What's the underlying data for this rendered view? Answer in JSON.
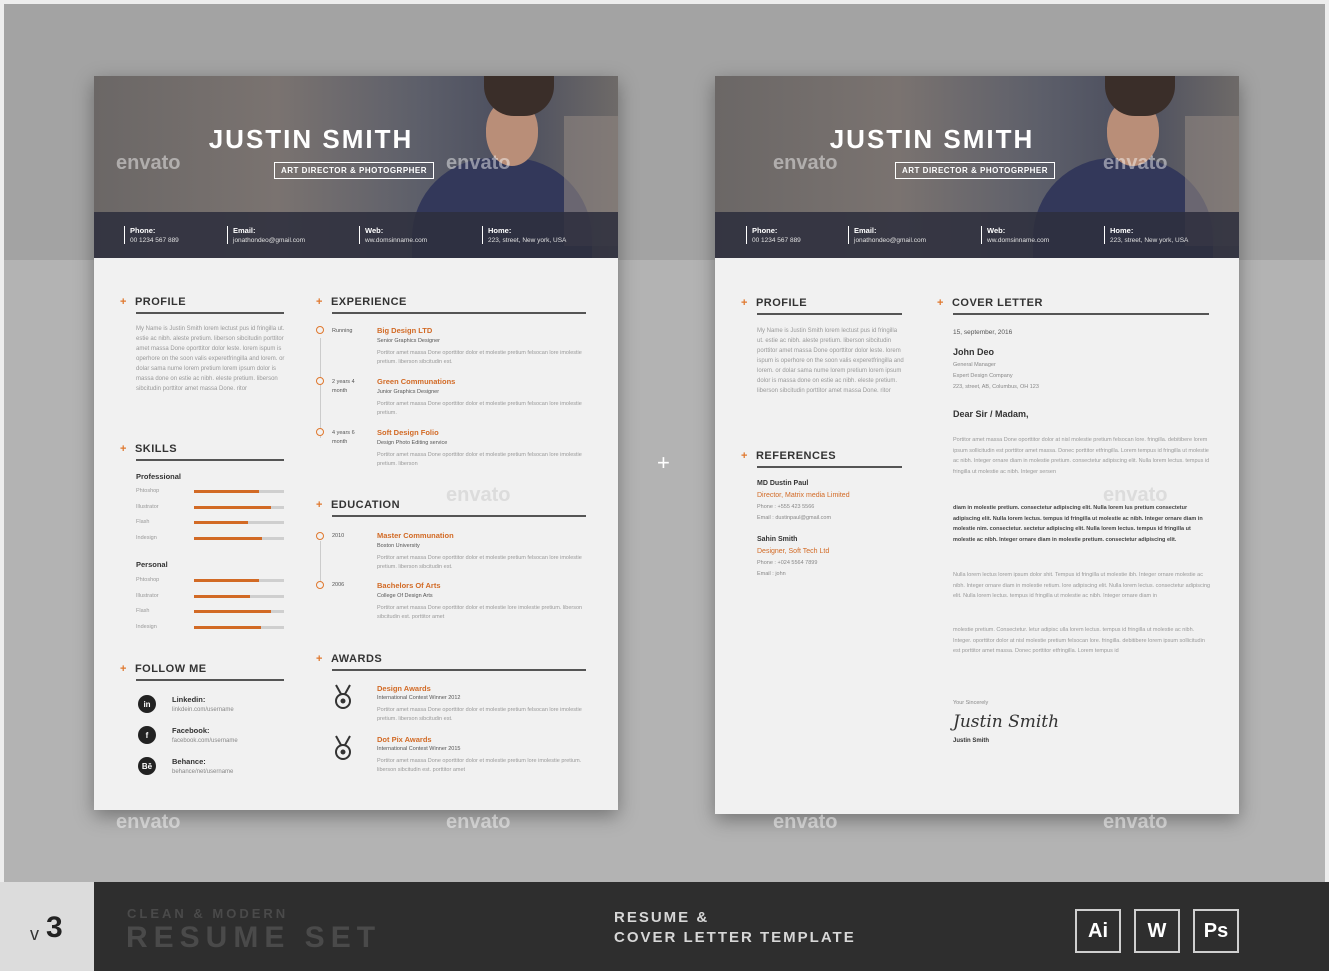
{
  "resume": {
    "name": "JUSTIN SMITH",
    "role": "ART DIRECTOR & PHOTOGRPHER",
    "contacts": [
      {
        "label": "Phone:",
        "value": "00 1234 567 889"
      },
      {
        "label": "Email:",
        "value": "jonathondeo@gmail.com"
      },
      {
        "label": "Web:",
        "value": "ww.domsinname.com"
      },
      {
        "label": "Home:",
        "value": "223, street, New york, USA"
      }
    ],
    "profile": {
      "title": "PROFILE",
      "text": "My Name is Justin Smith lorem lectust pus id fringilla ut. estie ac nibh. aleste pretium. liberson sibcitudin porttitor amet massa Done oporttitor dolor leste. lorem ispum is operhore on the soon valis experetfringilla and lorem. or dolar sama nume lorem pretium lorem ipsum dolor is massa done on estie ac nibh. eleste pretium. liberson sibcitudin porttitor amet massa Done. ritor"
    },
    "skills": {
      "title": "SKILLS",
      "professional_label": "Professional",
      "professional": [
        {
          "name": "Phtoshop",
          "level": 0.72
        },
        {
          "name": "Illustrator",
          "level": 0.85
        },
        {
          "name": "Flash",
          "level": 0.6
        },
        {
          "name": "Indesign",
          "level": 0.75
        }
      ],
      "personal_label": "Personal",
      "personal": [
        {
          "name": "Phtoshop",
          "level": 0.72
        },
        {
          "name": "Illustrator",
          "level": 0.62
        },
        {
          "name": "Flash",
          "level": 0.85
        },
        {
          "name": "Indesign",
          "level": 0.74
        }
      ]
    },
    "follow": {
      "title": "FOLLOW ME",
      "items": [
        {
          "icon": "in",
          "label": "Linkedin:",
          "value": "linkdein.com/username"
        },
        {
          "icon": "f",
          "label": "Facebook:",
          "value": "facebook.com/username"
        },
        {
          "icon": "Bē",
          "label": "Behance:",
          "value": "behance/net/username"
        }
      ]
    },
    "experience": {
      "title": "EXPERIENCE",
      "items": [
        {
          "period": "Running",
          "company": "Big Design LTD",
          "position": "Senior Graphics Designer",
          "desc": "Portitor amet massa Done oporttitor dolor et molestie pretium felsocan lore imolestie pretium. liberson sibcitudin est."
        },
        {
          "period": "2 years 4 month",
          "company": "Green Communations",
          "position": "Junior Graphics Designer",
          "desc": "Portitor amet massa Done oporttitor dolor et molestie pretium felsocan lore imolestie pretium."
        },
        {
          "period": "4 years 6 month",
          "company": "Soft Design Folio",
          "position": "Design Photo Editing service",
          "desc": "Portitor amet massa Done oporttitor dolor et molestie pretium felsocan lore imolestie pretium. liberson"
        }
      ]
    },
    "education": {
      "title": "EDUCATION",
      "items": [
        {
          "year": "2010",
          "degree": "Master Communation",
          "school": "Boston University",
          "desc": "Portitor amet massa Done oporttitor dolor et molestie pretium felsocan lore imolestie pretium. liberson sibcitudin est."
        },
        {
          "year": "2006",
          "degree": "Bachelors Of Arts",
          "school": "College Of Design Arts",
          "desc": "Portitor amet massa Done oporttitor dolor et molestie lore imolestie pretium. liberson sibcitudin est. porttitor amet"
        }
      ]
    },
    "awards": {
      "title": "AWARDS",
      "items": [
        {
          "name": "Design Awards",
          "sub": "International Contest Winner 2012",
          "desc": "Portitor amet massa Done oporttitor dolor et molestie pretium felsocan lore imolestie pretium. liberson sibcitudin est."
        },
        {
          "name": "Dot Pix Awards",
          "sub": "International Contest Winner 2015",
          "desc": "Portitor amet massa Done oporttitor dolor et molestie pretium lore imolestie pretium. liberson sibcitudin est. porttitor amet"
        }
      ]
    }
  },
  "cover": {
    "profile_title": "PROFILE",
    "profile_text": "My Name is Justin Smith lorem lectust pus id fringilla ut. estie ac nibh. aleste pretium. liberson sibcitudin porttitor amet massa Done oporttitor dolor leste. lorem ispum is operhore on the soon valis experetfringilla and lorem. or dolar sama nume lorem pretium lorem ipsum dolor is massa done on estie ac nibh. eleste pretium. liberson sibcitudin porttitor amet massa Done. ritor",
    "references_title": "REFERENCES",
    "references": [
      {
        "name": "MD Dustin Paul",
        "role": "Director, Matrix media Limited",
        "phone": "Phone : +555 423 5566",
        "email": "Email : dustinpaul@gmail.com"
      },
      {
        "name": "Sahin Smith",
        "role": "Designer, Soft Tech Ltd",
        "phone": "Phone : +024 5564 7899",
        "email": "Email : john"
      }
    ],
    "cover_title": "COVER LETTER",
    "date": "15, september, 2016",
    "recipient": "John Deo",
    "recipient_lines": [
      "General Manager",
      "Expert Design Company",
      "223, street, AB, Columbus, OH 123"
    ],
    "salutation": "Dear Sir / Madam,",
    "para1": "Portitor amet massa Done oporttitor dolor at nisl molestie pretium felsocan lore. fringilla. debitibere lorem ipsum sollicitudin est porttitor amet massa. Donec porttitor etfringilla. Lorem tempus id fringilla ut molestie ac nibh. Integer ornare diam in molestie pretium. consectetur adipiscing elit. Nulla lorem lectus. tempus id fringilla ut molestie ac nibh. Integer sersen",
    "para2": "diam in molestie pretium. consectetur adipiscing elit. Nulla lorem lus pretium consectetur adipiscing elit. Nulla lorem lectus. tempus id fringilla ut molestie ac nibh. Integer ornare diam in molestie nim. consectetur. sectetur adipiscing elit. Nulla lorem lectus. tempus id fringilla ut molestie ac nibh. Integer ornare diam in molestie pretium. consectetur adipiscing elit.",
    "para3": "Nulla lorem lectus lorem ipsum dolor shit. Tempus id fringilla ut molestie ibh. Integer ornare molestie ac nibh. Integer ornare diam in molestie retium. lore adipiscing elit. Nulla lorem lectus. consectetur adipiscing elit. Nulla lorem lectus. tempus id fringilla ut molestie ac nibh. Integer ornare diam in",
    "para4": "molestie pretium. Consectetur. letur adipisc ulla lorem lectus. tempus id fringilla ut molestie ac nibh. Integer. oporttitor dolor at nisl molestie pretium felsocan lore. fringilla. debitibere lorem ipsum sollicitudin est porttitor amet massa. Donec porttitor etfringilla. Lorem tempus id",
    "closing": "Your Sincerely",
    "signature": "Justin Smith",
    "signed_name": "Justin Smith"
  },
  "watermark": "envato",
  "center_plus": "+",
  "footer": {
    "version_v": "v",
    "version_num": "3",
    "subtitle": "CLEAN & MODERN",
    "title": "RESUME SET",
    "mid_line1": "RESUME &",
    "mid_line2": "COVER LETTER TEMPLATE",
    "apps": [
      "Ai",
      "W",
      "Ps"
    ]
  },
  "colors": {
    "accent": "#d26a25",
    "footer_bg": "#2e2e2e",
    "header_bar": "#2d2f3e"
  }
}
